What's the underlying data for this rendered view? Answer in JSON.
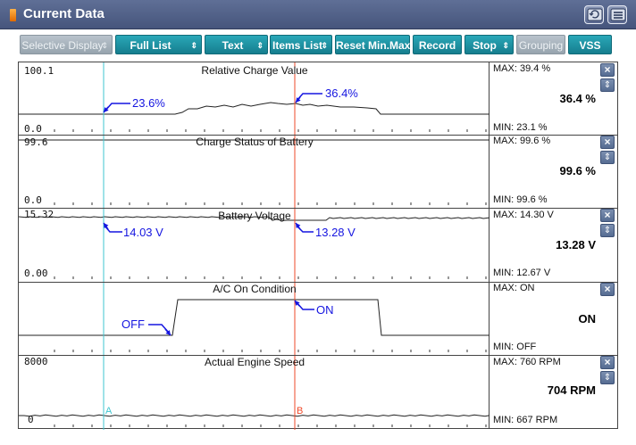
{
  "window": {
    "title": "Current Data",
    "retry_icon": "retry-icon",
    "menu_icon": "menu-icon"
  },
  "toolbar": {
    "selective_display": "Selective Display",
    "full_list": "Full List",
    "text": "Text",
    "items_list": "Items List",
    "reset_min_max": "Reset Min.Max",
    "record": "Record",
    "stop": "Stop",
    "grouping": "Grouping",
    "vss": "VSS"
  },
  "colors": {
    "cursor_a": "#3fc6d0",
    "cursor_b": "#ef4a2a",
    "annotation": "#1515e0",
    "trace": "#222222"
  },
  "cursors": {
    "a_label": "A",
    "b_label": "B"
  },
  "panels": [
    {
      "title": "Relative Charge Value",
      "y_max": "100.1",
      "y_min": "0.0",
      "max": "MAX:  39.4 %",
      "min": "MIN:  23.1 %",
      "current": "36.4 %",
      "annot_a": "23.6%",
      "annot_b": "36.4%"
    },
    {
      "title": "Charge Status of Battery",
      "y_max": "99.6",
      "y_min": "0.0",
      "max": "MAX:  99.6 %",
      "min": "MIN:  99.6 %",
      "current": "99.6 %"
    },
    {
      "title": "Battery Voltage",
      "y_max": "15.32",
      "y_min": "0.00",
      "max": "MAX:  14.30 V",
      "min": "MIN:  12.67 V",
      "current": "13.28 V",
      "annot_a": "14.03 V",
      "annot_b": "13.28 V"
    },
    {
      "title": "A/C On Condition",
      "max": "MAX:  ON",
      "min": "MIN:  OFF",
      "current": "ON",
      "annot_a": "OFF",
      "annot_b": "ON"
    },
    {
      "title": "Actual Engine Speed",
      "y_max": "8000",
      "y_min": "0",
      "max": "MAX:    760 RPM",
      "min": "MIN:    667 RPM",
      "current": "704 RPM"
    }
  ]
}
